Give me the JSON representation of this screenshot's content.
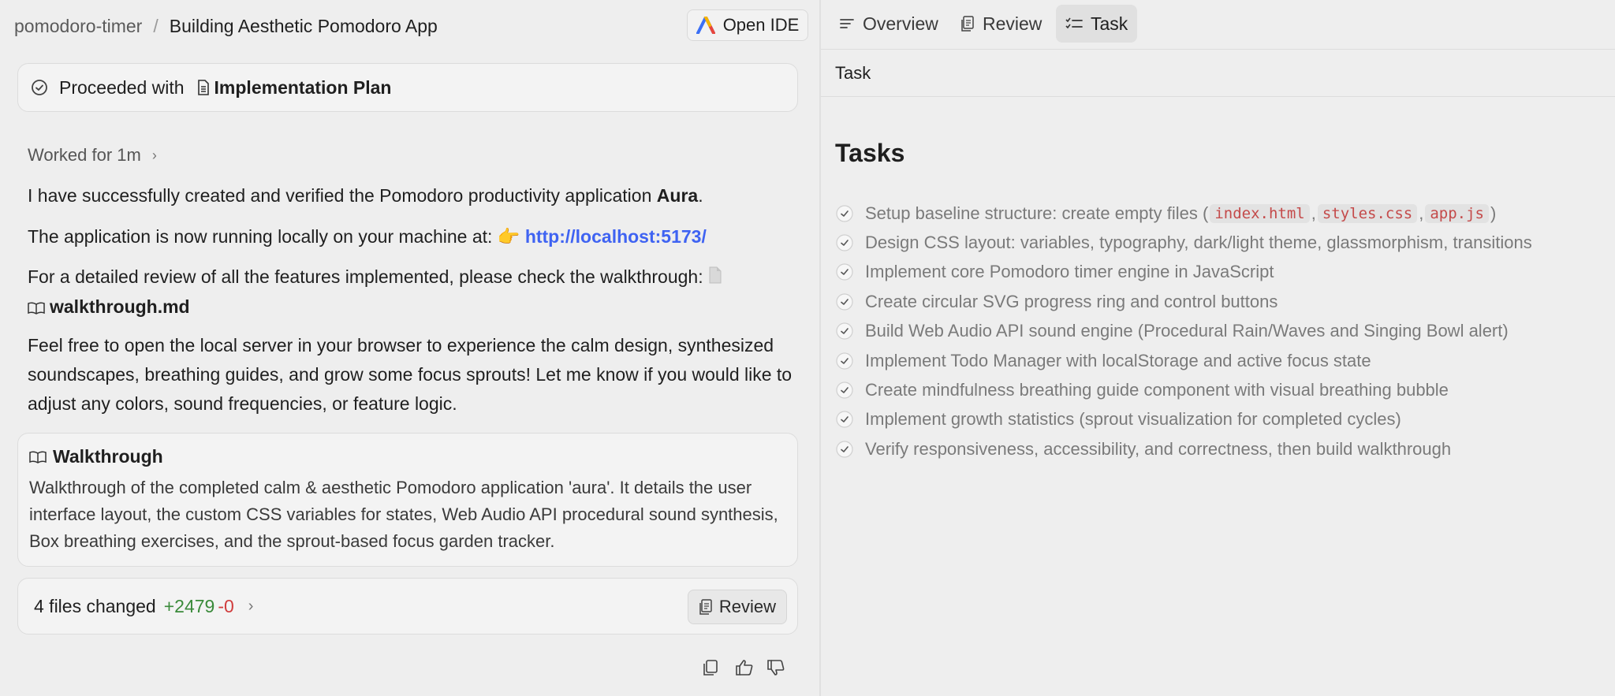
{
  "header": {
    "project": "pomodoro-timer",
    "separator": "/",
    "title": "Building Aesthetic Pomodoro App",
    "open_ide_label": "Open IDE"
  },
  "proceeded": {
    "prefix": "Proceeded with",
    "artifact": "Implementation Plan"
  },
  "worked": {
    "label": "Worked for 1m"
  },
  "message": {
    "line1_pre": "I have successfully created and verified the Pomodoro productivity application ",
    "line1_bold": "Aura",
    "line1_post": ".",
    "line2_pre": "The application is now running locally on your machine at: ",
    "line2_emoji": "👉",
    "line2_link": "http://localhost:5173/",
    "line3_pre": "For a detailed review of all the features implemented, please check the walkthrough: ",
    "line3_file": "walkthrough.md",
    "line4": "Feel free to open the local server in your browser to experience the calm design, synthesized soundscapes, breathing guides, and grow some focus sprouts! Let me know if you would like to adjust any colors, sound frequencies, or feature logic."
  },
  "walkthrough": {
    "title": "Walkthrough",
    "description": "Walkthrough of the completed calm & aesthetic Pomodoro application 'aura'. It details the user interface layout, the custom CSS variables for states, Web Audio API procedural sound synthesis, Box breathing exercises, and the sprout-based focus garden tracker."
  },
  "changes": {
    "files_label": "4 files changed",
    "additions": "+2479",
    "deletions": "-0",
    "review_label": "Review"
  },
  "tabs": [
    {
      "label": "Overview",
      "icon": "list-icon"
    },
    {
      "label": "Review",
      "icon": "review-doc-icon"
    },
    {
      "label": "Task",
      "icon": "checklist-icon",
      "active": true
    }
  ],
  "task_panel": {
    "subheading": "Task",
    "title": "Tasks",
    "items": [
      {
        "pre": "Setup baseline structure: create empty files (",
        "codes": [
          "index.html",
          "styles.css",
          "app.js"
        ],
        "post": ")"
      },
      {
        "text": "Design CSS layout: variables, typography, dark/light theme, glassmorphism, transitions"
      },
      {
        "text": "Implement core Pomodoro timer engine in JavaScript"
      },
      {
        "text": "Create circular SVG progress ring and control buttons"
      },
      {
        "text": "Build Web Audio API sound engine (Procedural Rain/Waves and Singing Bowl alert)"
      },
      {
        "text": "Implement Todo Manager with localStorage and active focus state"
      },
      {
        "text": "Create mindfulness breathing guide component with visual breathing bubble"
      },
      {
        "text": "Implement growth statistics (sprout visualization for completed cycles)"
      },
      {
        "text": "Verify responsiveness, accessibility, and correctness, then build walkthrough"
      }
    ]
  },
  "colors": {
    "background": "#eeeeee",
    "link": "#3f63f2",
    "addition": "#3a8a3a",
    "deletion": "#d03c3c",
    "code_text": "#c44a4a"
  }
}
